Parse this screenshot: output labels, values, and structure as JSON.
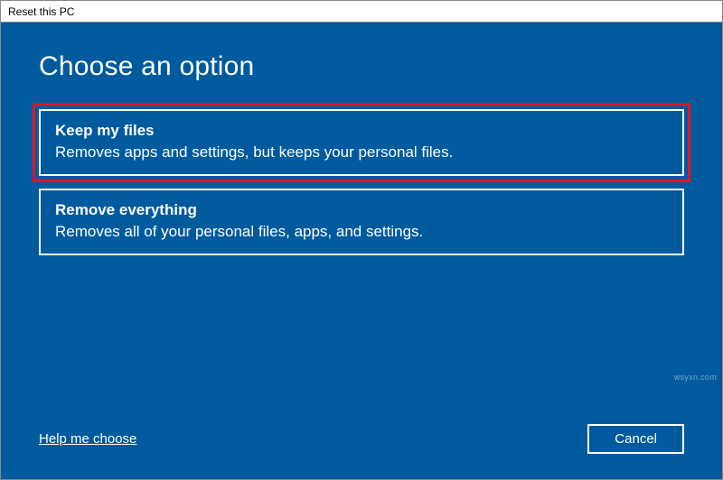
{
  "window": {
    "title": "Reset this PC"
  },
  "main": {
    "heading": "Choose an option"
  },
  "options": {
    "keep": {
      "title": "Keep my files",
      "desc": "Removes apps and settings, but keeps your personal files."
    },
    "remove": {
      "title": "Remove everything",
      "desc": "Removes all of your personal files, apps, and settings."
    }
  },
  "footer": {
    "help_label": "Help me choose",
    "cancel_label": "Cancel"
  },
  "watermark": "wsyxn.com"
}
